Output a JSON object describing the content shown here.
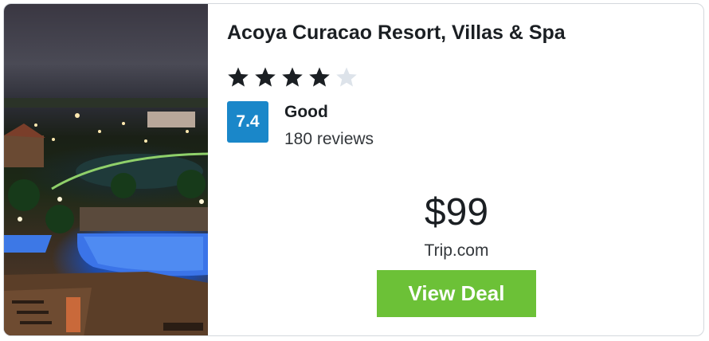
{
  "hotel": {
    "name": "Acoya Curacao Resort, Villas & Spa",
    "star_rating": 4,
    "star_max": 5,
    "star_filled_color": "#1b1f23",
    "star_empty_color": "#dde3ea"
  },
  "rating": {
    "score": "7.4",
    "label": "Good",
    "reviews": "180 reviews",
    "badge_color": "#1a87c9"
  },
  "offer": {
    "price": "$99",
    "provider": "Trip.com",
    "cta_label": "View Deal",
    "cta_color": "#6cc137"
  },
  "photo": {
    "subject": "resort-night-pool-photo"
  }
}
